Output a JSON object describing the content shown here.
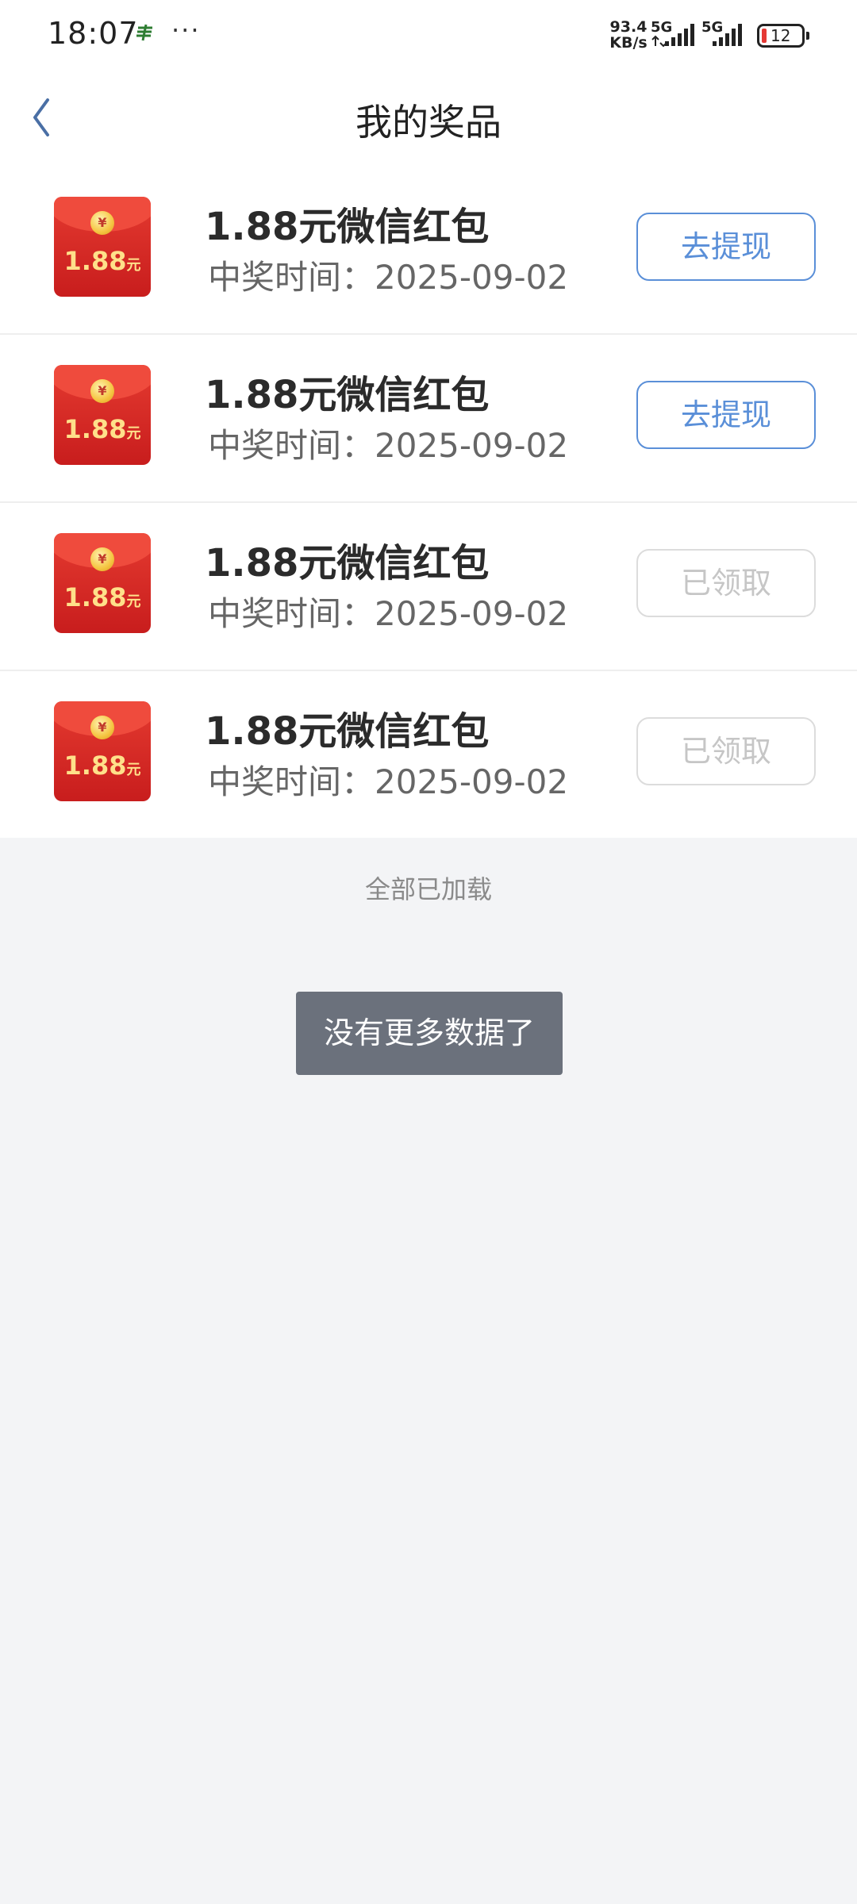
{
  "status_bar": {
    "time": "18:07",
    "more": "···",
    "network_speed": "93.4\nKB/s",
    "signal1_label": "5G",
    "signal2_label": "5G",
    "battery_level": "12"
  },
  "header": {
    "title": "我的奖品"
  },
  "prizes": [
    {
      "name": "1.88元微信红包",
      "time": "中奖时间：2025-09-02",
      "amount": "1.88",
      "unit": "元",
      "action": "去提现",
      "status": "active"
    },
    {
      "name": "1.88元微信红包",
      "time": "中奖时间：2025-09-02",
      "amount": "1.88",
      "unit": "元",
      "action": "去提现",
      "status": "active"
    },
    {
      "name": "1.88元微信红包",
      "time": "中奖时间：2025-09-02",
      "amount": "1.88",
      "unit": "元",
      "action": "已领取",
      "status": "done"
    },
    {
      "name": "1.88元微信红包",
      "time": "中奖时间：2025-09-02",
      "amount": "1.88",
      "unit": "元",
      "action": "已领取",
      "status": "done"
    }
  ],
  "footer": {
    "all_loaded": "全部已加载"
  },
  "toast": {
    "message": "没有更多数据了"
  },
  "colors": {
    "accent": "#5a8fd8",
    "envelope_red": "#d52a25",
    "background": "#f3f4f6"
  }
}
